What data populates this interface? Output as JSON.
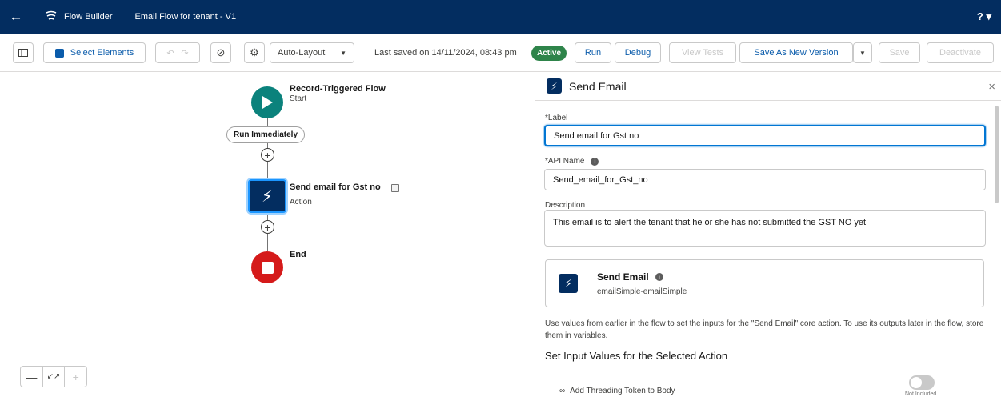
{
  "header": {
    "app_name": "Flow Builder",
    "flow_name": "Email Flow for tenant - V1",
    "help_label": "? ▾"
  },
  "toolbar": {
    "select_elements": "Select Elements",
    "layout_select": "Auto-Layout",
    "last_saved": "Last saved on 14/11/2024, 08:43 pm",
    "status": "Active",
    "run": "Run",
    "debug": "Debug",
    "view_tests": "View Tests",
    "save_new_version": "Save As New Version",
    "save": "Save",
    "deactivate": "Deactivate"
  },
  "canvas": {
    "start": {
      "title": "Record-Triggered Flow",
      "subtitle": "Start"
    },
    "path": "Run Immediately",
    "action": {
      "title": "Send email for Gst no",
      "subtitle": "Action"
    },
    "end": {
      "title": "End"
    }
  },
  "panel": {
    "title": "Send Email",
    "label_label": "*Label",
    "label_value": "Send email for Gst no",
    "api_label": "*API Name",
    "api_value": "Send_email_for_Gst_no",
    "description_label": "Description",
    "description_value": "This email is to alert the tenant that he or she has not submitted the GST NO yet",
    "action_card": {
      "title": "Send Email",
      "subtitle": "emailSimple-emailSimple"
    },
    "help_text": "Use values from earlier in the flow to set the inputs for the \"Send Email\" core action. To use its outputs later in the flow, store them in variables.",
    "section_title": "Set Input Values for the Selected Action",
    "threading_label": "Add Threading Token to Body",
    "toggle_state": "Not Included"
  },
  "colors": {
    "header_bg": "#032d60",
    "active_green": "#2e844a",
    "start_teal": "#0b827c",
    "end_red": "#d51a1a",
    "focus_blue": "#0176d3"
  }
}
